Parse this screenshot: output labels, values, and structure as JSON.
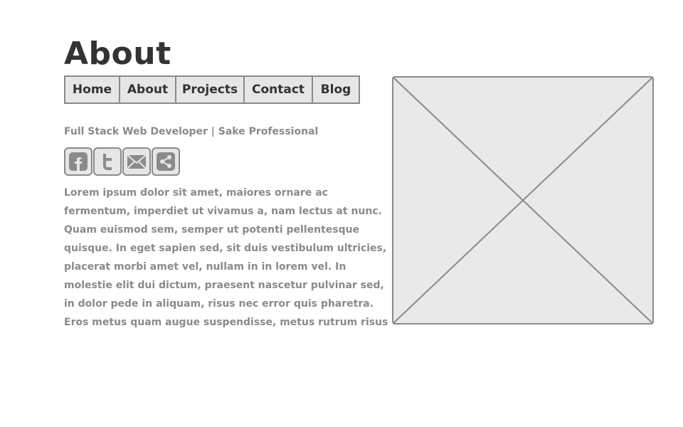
{
  "page": {
    "title": "About"
  },
  "nav": {
    "items": [
      {
        "label": "Home"
      },
      {
        "label": "About"
      },
      {
        "label": "Projects"
      },
      {
        "label": "Contact"
      },
      {
        "label": "Blog"
      }
    ]
  },
  "profile": {
    "subtitle": "Full Stack Web Developer | Sake Professional",
    "bio": "Lorem ipsum dolor sit amet, maiores ornare ac fermentum, imperdiet ut vivamus a, nam lectus at nunc. Quam euismod sem, semper ut potenti pellentesque quisque. In eget sapien sed, sit duis vestibulum ultricies, placerat morbi amet vel, nullam in in lorem vel. In molestie elit dui dictum, praesent nascetur pulvinar sed, in dolor pede in aliquam, risus nec error quis pharetra. Eros metus quam augue suspendisse, metus rutrum risus erat in.  In ultrices quo ut lectus, etiam"
  },
  "social": {
    "icons": [
      "facebook-icon",
      "twitter-icon",
      "email-icon",
      "share-icon"
    ]
  },
  "colors": {
    "text_dark": "#333333",
    "text_muted": "#8a8a8a",
    "fill": "#e6e6e6",
    "border": "#8a8a8a"
  }
}
